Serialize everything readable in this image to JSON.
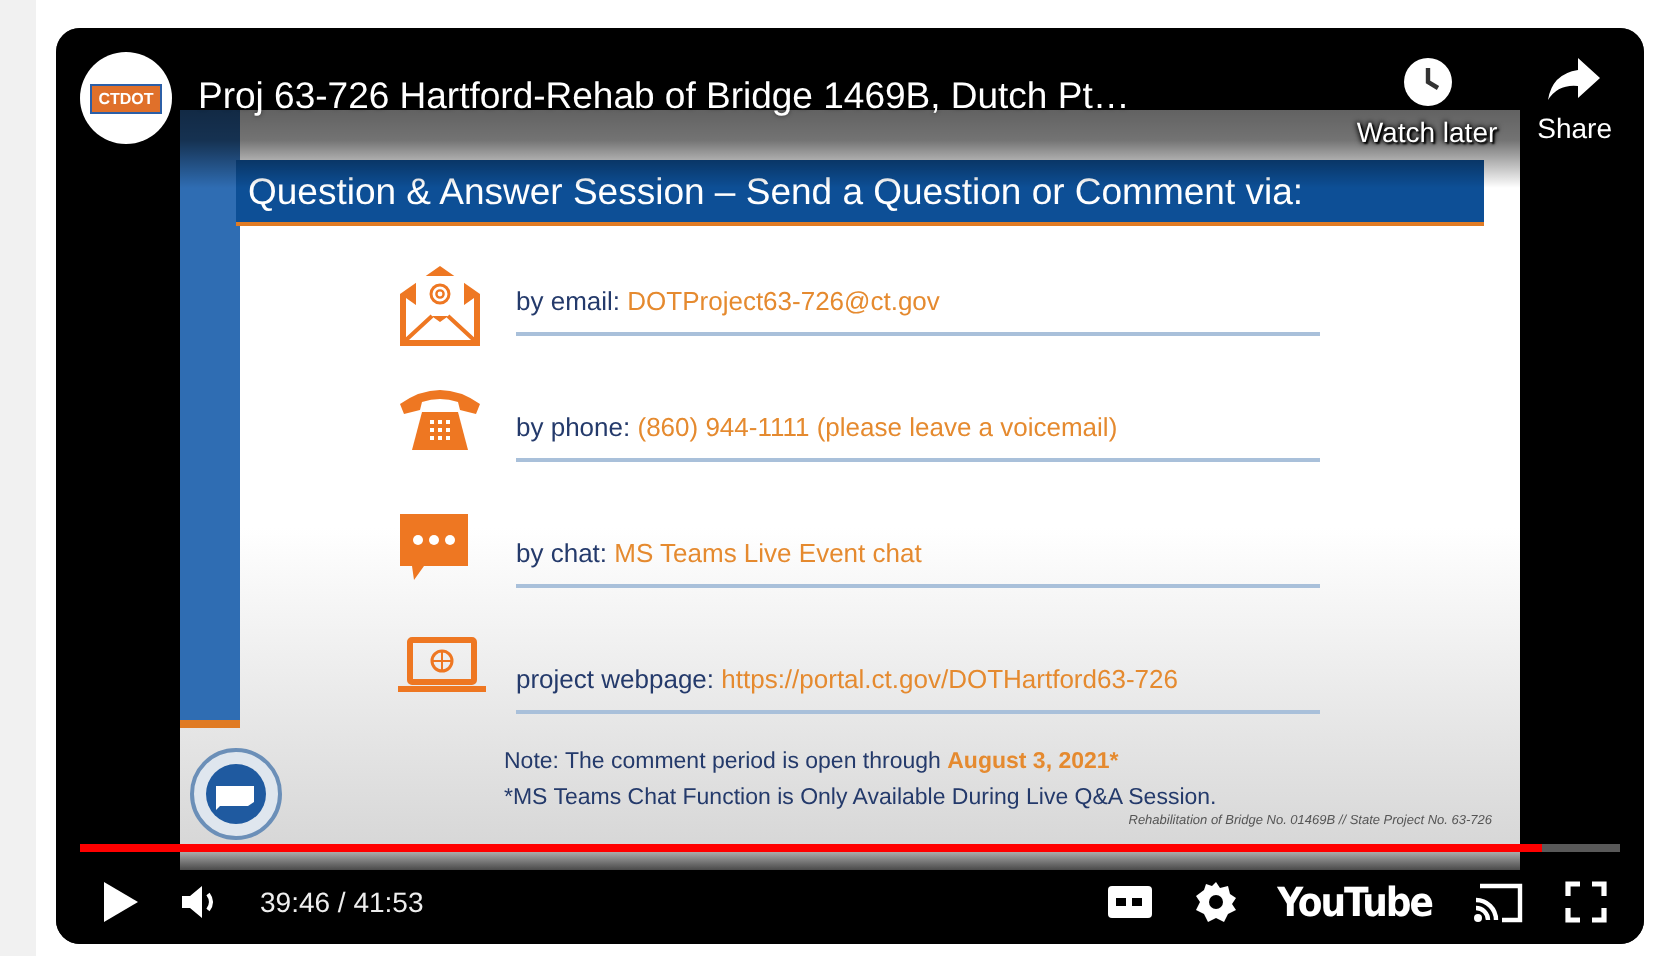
{
  "player": {
    "channel_logo": "CTDOT",
    "title": "Proj 63-726 Hartford-Rehab of Bridge 1469B, Dutch Pt…",
    "actions": [
      {
        "kind": "watch_later",
        "label": "Watch later"
      },
      {
        "kind": "share",
        "label": "Share"
      }
    ],
    "progress": {
      "level": 0.949
    },
    "time": "39:46 / 41:53",
    "brand": "YouTube"
  },
  "slide": {
    "heading": "Question & Answer Session – Send a Question or Comment via:",
    "contacts": [
      {
        "kind": "email",
        "label": "by email:",
        "value": "DOTProject63-726@ct.gov"
      },
      {
        "kind": "phone",
        "label": "by phone:",
        "value": "(860) 944-1111 (please leave a voicemail)"
      },
      {
        "kind": "chat",
        "label": "by chat:",
        "value": "MS Teams Live Event chat"
      },
      {
        "kind": "web",
        "label": "project webpage:",
        "value": "https://portal.ct.gov/DOTHartford63-726"
      }
    ],
    "note": {
      "text": "Note: The comment period is open through",
      "date": "August 3, 2021*"
    },
    "footnote": "*MS Teams Chat Function is Only Available During Live Q&A Session.",
    "footer": "Rehabilitation of Bridge No. 01469B // State Project No. 63-726"
  }
}
